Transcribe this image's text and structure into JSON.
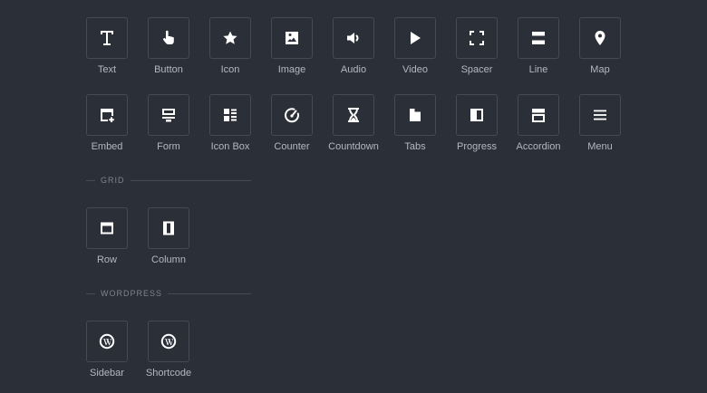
{
  "basic": {
    "items": [
      {
        "label": "Text",
        "icon": "text-icon"
      },
      {
        "label": "Button",
        "icon": "hand-pointer-icon"
      },
      {
        "label": "Icon",
        "icon": "star-icon"
      },
      {
        "label": "Image",
        "icon": "image-icon"
      },
      {
        "label": "Audio",
        "icon": "speaker-icon"
      },
      {
        "label": "Video",
        "icon": "play-icon"
      },
      {
        "label": "Spacer",
        "icon": "expand-corners-icon"
      },
      {
        "label": "Line",
        "icon": "line-icon"
      },
      {
        "label": "Map",
        "icon": "map-pin-icon"
      },
      {
        "label": "Embed",
        "icon": "embed-window-icon"
      },
      {
        "label": "Form",
        "icon": "form-icon"
      },
      {
        "label": "Icon Box",
        "icon": "icon-box-icon"
      },
      {
        "label": "Counter",
        "icon": "counter-gauge-icon"
      },
      {
        "label": "Countdown",
        "icon": "hourglass-icon"
      },
      {
        "label": "Tabs",
        "icon": "tabs-icon"
      },
      {
        "label": "Progress",
        "icon": "progress-icon"
      },
      {
        "label": "Accordion",
        "icon": "accordion-icon"
      },
      {
        "label": "Menu",
        "icon": "hamburger-menu-icon"
      }
    ]
  },
  "grid": {
    "title": "GRID",
    "items": [
      {
        "label": "Row",
        "icon": "row-icon"
      },
      {
        "label": "Column",
        "icon": "column-icon"
      }
    ]
  },
  "wordpress": {
    "title": "WORDPRESS",
    "items": [
      {
        "label": "Sidebar",
        "icon": "wordpress-icon"
      },
      {
        "label": "Shortcode",
        "icon": "wordpress-icon"
      }
    ]
  },
  "colors": {
    "background": "#2b2f37",
    "tile_border": "#454b55",
    "label": "#b3b8c1",
    "section_header": "#7d838d",
    "icon": "#ffffff"
  }
}
